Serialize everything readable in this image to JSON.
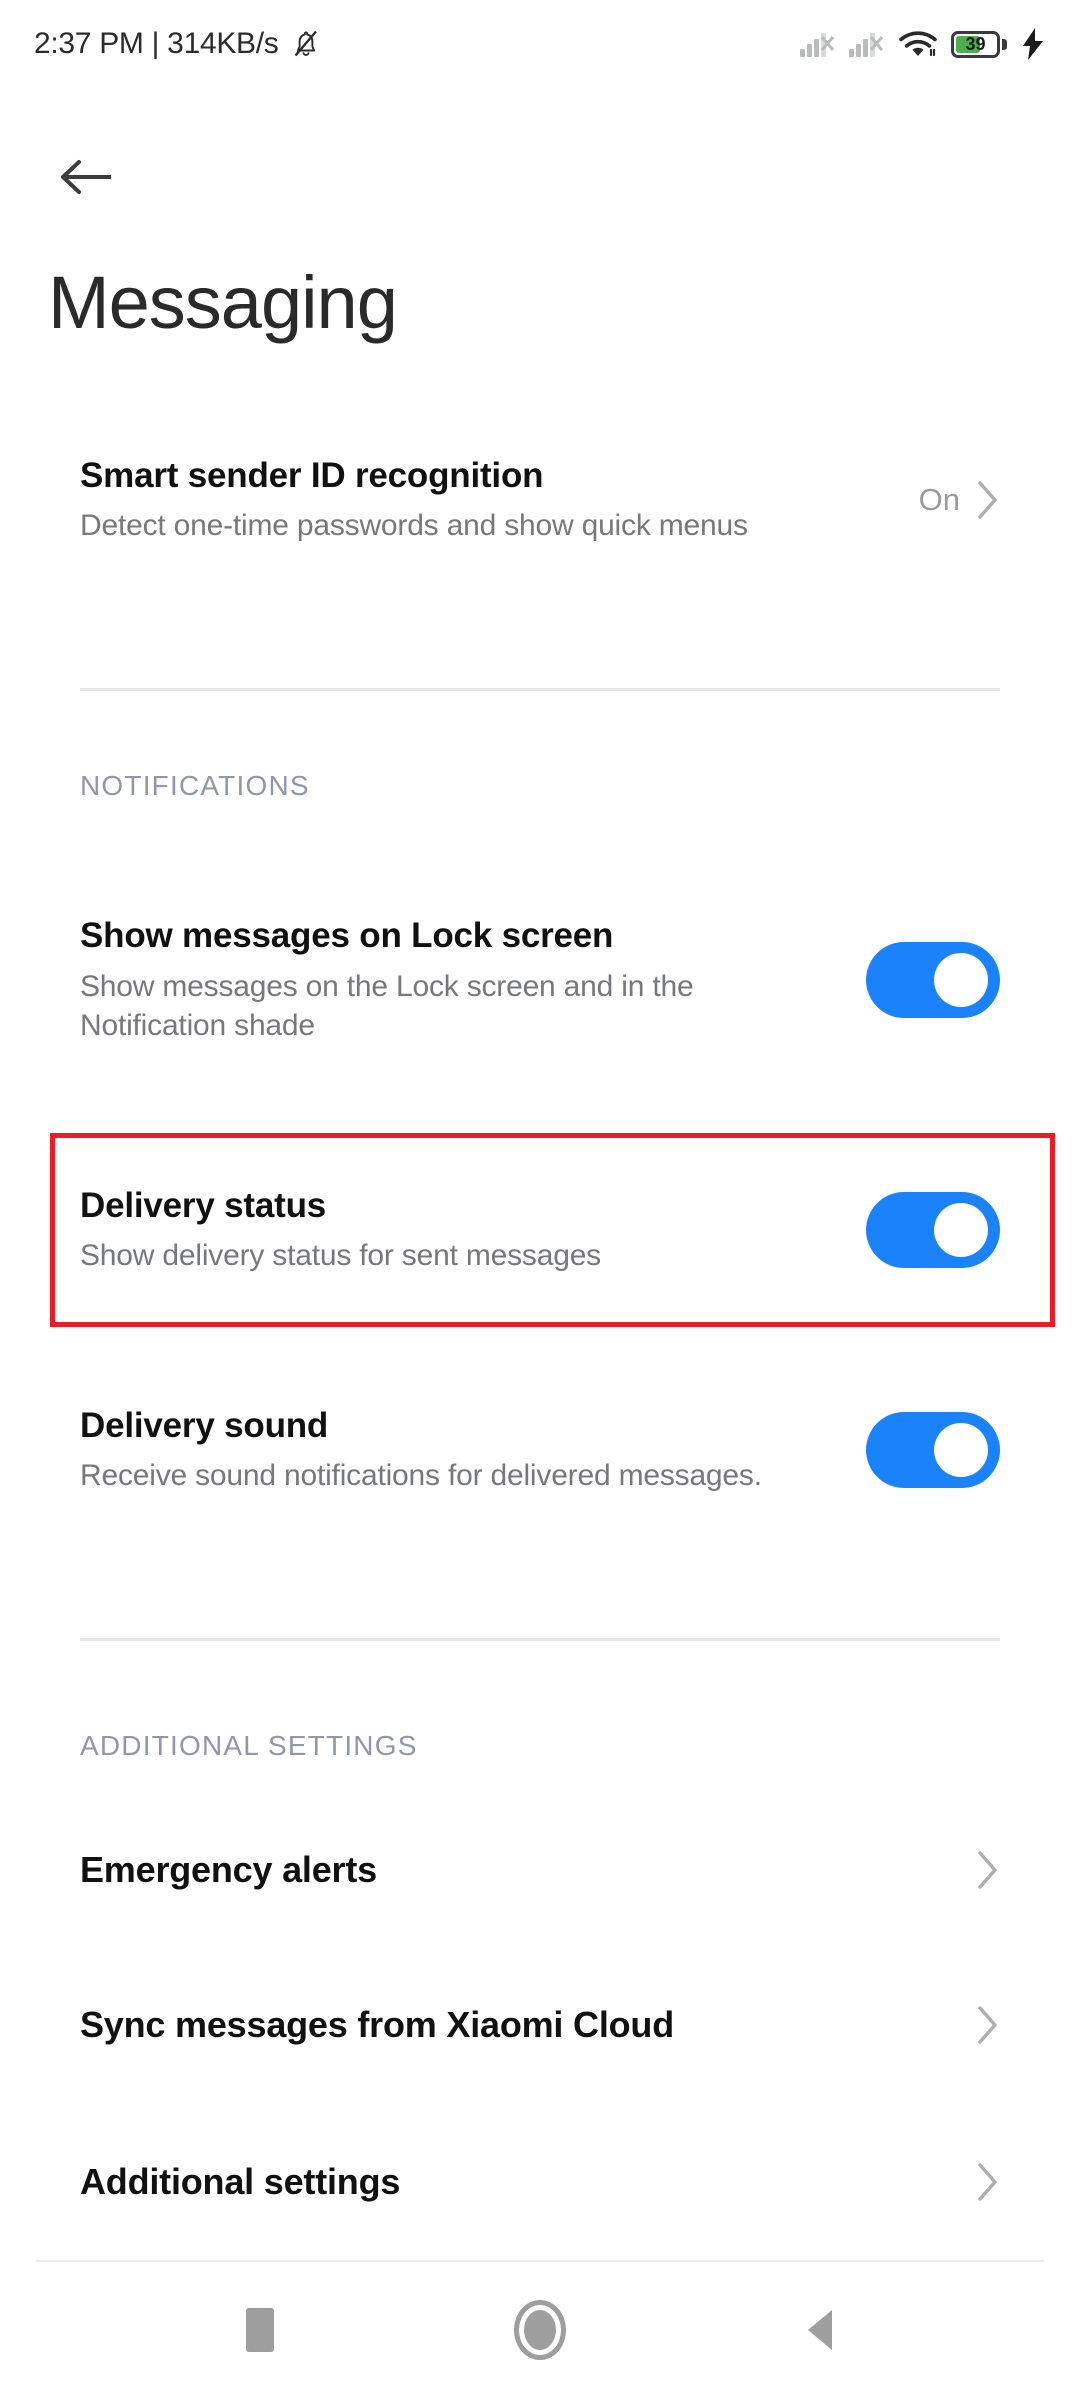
{
  "statusbar": {
    "clock_and_net": "2:37 PM | 314KB/s",
    "mute_icon": "bell-muted-icon",
    "signal_1_icon": "signal-no-sim-icon",
    "signal_2_icon": "signal-no-sim-icon",
    "wifi_icon": "wifi-icon",
    "battery_level": "39",
    "battery_fill_percent": 39,
    "charging_icon": "charging-bolt-icon",
    "battery_color": "#4caf50"
  },
  "header": {
    "back_icon": "arrow-back-icon",
    "title": "Messaging"
  },
  "smart_sender": {
    "title": "Smart sender ID recognition",
    "subtitle": "Detect one-time passwords and show quick menus",
    "value": "On",
    "chevron_icon": "chevron-right-icon"
  },
  "notifications": {
    "section_label": "NOTIFICATIONS",
    "items": [
      {
        "title": "Show messages on Lock screen",
        "subtitle": "Show messages on the Lock screen and in the Notification shade",
        "toggle_state": "on"
      },
      {
        "title": "Delivery status",
        "subtitle": "Show delivery status for sent messages",
        "toggle_state": "on",
        "highlighted": true
      },
      {
        "title": "Delivery sound",
        "subtitle": "Receive sound notifications for delivered messages.",
        "toggle_state": "on"
      }
    ]
  },
  "additional": {
    "section_label": "ADDITIONAL SETTINGS",
    "items": [
      {
        "title": "Emergency alerts",
        "chevron_icon": "chevron-right-icon"
      },
      {
        "title": "Sync messages from Xiaomi Cloud",
        "chevron_icon": "chevron-right-icon"
      },
      {
        "title": "Additional settings",
        "chevron_icon": "chevron-right-icon"
      }
    ]
  },
  "navbar": {
    "recents_icon": "square-recents-icon",
    "home_icon": "circle-home-icon",
    "back_icon": "triangle-back-icon"
  },
  "colors": {
    "toggle_on": "#1a82fb",
    "highlight": "#ec1c24",
    "section_label": "#9296ab",
    "subtitle": "#77787b"
  }
}
